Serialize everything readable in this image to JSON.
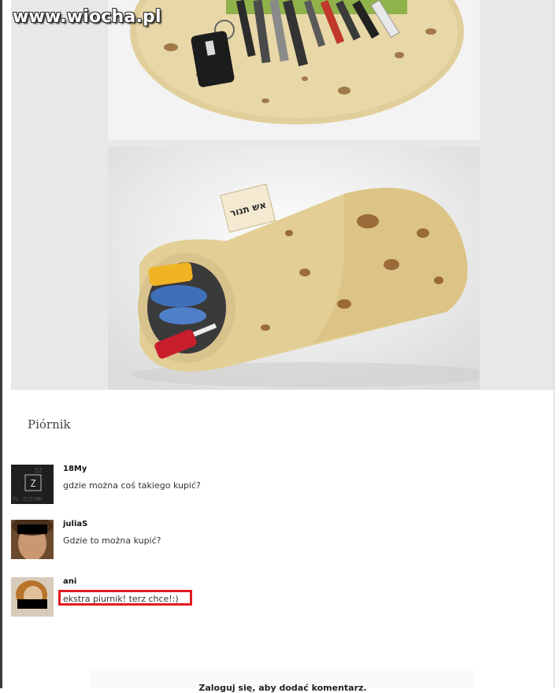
{
  "watermark": "www.wiocha.pl",
  "post": {
    "title": "Piórnik"
  },
  "comments": [
    {
      "author": "18My",
      "text": "gdzie można coś takiego kupić?"
    },
    {
      "author": "juliaS",
      "text": "Gdzie to można kupić?"
    },
    {
      "author": "ani",
      "text": "ekstra piurnik! terz chce!:)"
    }
  ],
  "login_prompt": "Zaloguj się, aby dodać komentarz.",
  "photo_tag_text": "אש תנור",
  "colors": {
    "highlight": "#e11b22",
    "panel": "#e8e8e8"
  }
}
